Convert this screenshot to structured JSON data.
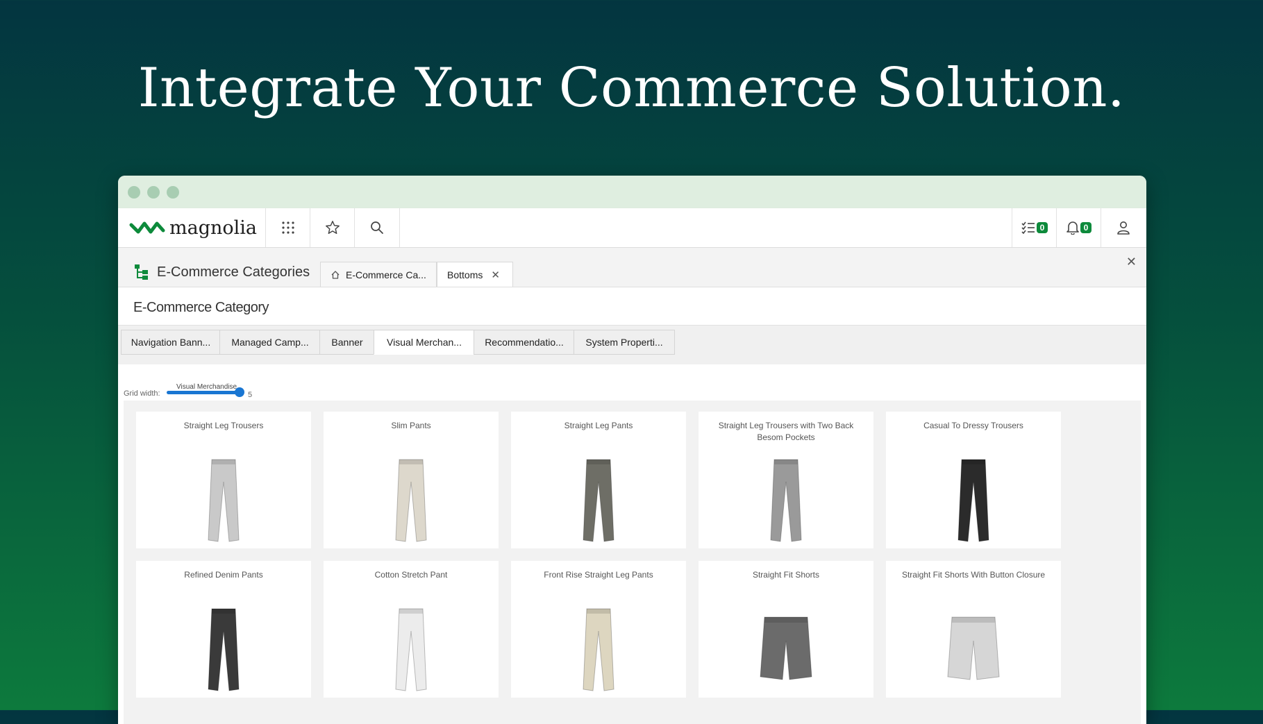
{
  "headline": "Integrate Your Commerce Solution.",
  "topbar": {
    "brand": "magnolia",
    "tasks_count": "0",
    "notifications_count": "0"
  },
  "app": {
    "name": "E-Commerce Categories",
    "tabs": [
      {
        "label": "E-Commerce Ca..."
      },
      {
        "label": "Bottoms"
      }
    ]
  },
  "form": {
    "title": "E-Commerce Category",
    "subtabs": [
      {
        "label": "Navigation Bann..."
      },
      {
        "label": "Managed Camp..."
      },
      {
        "label": "Banner"
      },
      {
        "label": "Visual Merchan..."
      },
      {
        "label": "Recommendatio..."
      },
      {
        "label": "System Properti..."
      }
    ],
    "active_subtab": "Visual Merchan..."
  },
  "grid": {
    "grid_width_label": "Grid width:",
    "slider_tooltip": "Visual Merchandise",
    "slider_value": "5",
    "products": [
      {
        "title": "Straight Leg Trousers",
        "color": "#c9c9c9",
        "kind": "pants"
      },
      {
        "title": "Slim Pants",
        "color": "#ddd8cc",
        "kind": "pants"
      },
      {
        "title": "Straight Leg Pants",
        "color": "#6e6e66",
        "kind": "pants"
      },
      {
        "title": "Straight Leg Trousers with Two Back Besom Pockets",
        "color": "#9a9a9a",
        "kind": "pants"
      },
      {
        "title": "Casual To Dressy Trousers",
        "color": "#2b2b2b",
        "kind": "pants"
      },
      {
        "title": "Refined Denim Pants",
        "color": "#3a3a3a",
        "kind": "pants"
      },
      {
        "title": "Cotton Stretch Pant",
        "color": "#ececec",
        "kind": "pants"
      },
      {
        "title": "Front Rise Straight Leg Pants",
        "color": "#ddd6c0",
        "kind": "pants"
      },
      {
        "title": "Straight Fit Shorts",
        "color": "#6b6b6b",
        "kind": "shorts"
      },
      {
        "title": "Straight Fit Shorts With Button Closure",
        "color": "#d6d6d6",
        "kind": "shorts"
      }
    ]
  }
}
